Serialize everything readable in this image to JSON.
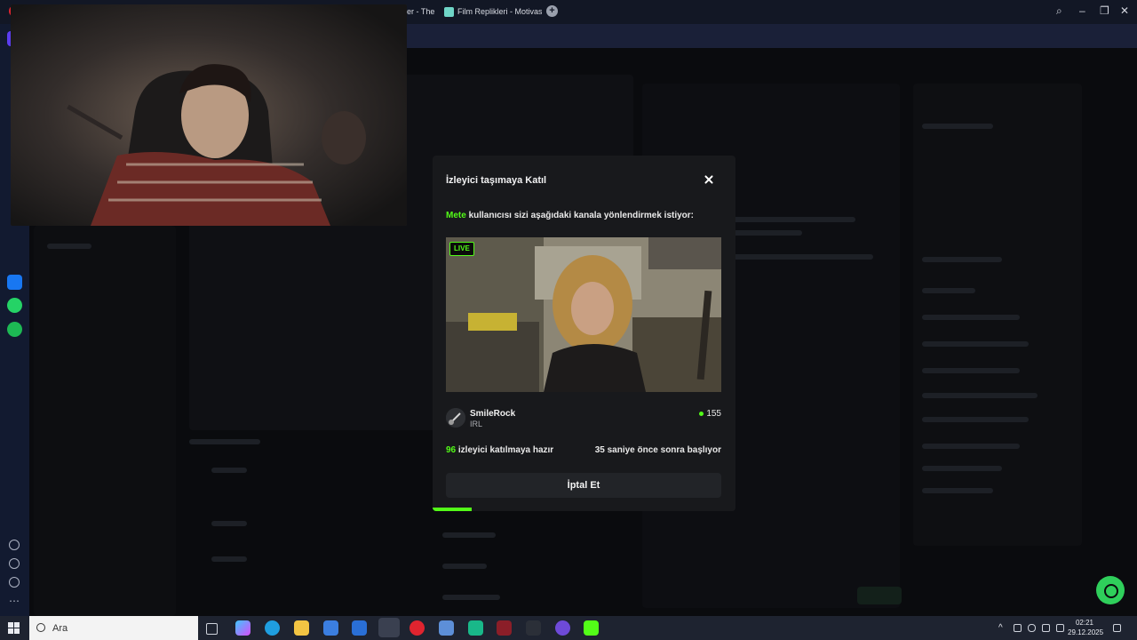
{
  "browser": {
    "tabs": [
      {
        "label": "The Godfather - The"
      },
      {
        "label": "Film Replikleri - Motivasyo"
      }
    ],
    "new_tab": "+",
    "ai_label": "AI"
  },
  "modal": {
    "title": "İzleyici taşımaya Katıl",
    "redirect_user": "Mete",
    "redirect_message": " kullanıcısı sizi aşağıdaki kanala yönlendirmek istiyor:",
    "live_badge": "LIVE",
    "channel": {
      "name": "SmileRock",
      "category": "IRL",
      "viewers": "155"
    },
    "ready_count": "96",
    "ready_label": " izleyici katılmaya hazır",
    "countdown": "35 saniye önce sonra başlıyor",
    "cancel_label": "İptal Et",
    "progress_fraction": 0.13
  },
  "taskbar": {
    "search_placeholder": "Ara",
    "time": "02:21",
    "date": "29.12.2025"
  },
  "colors": {
    "accent": "#53fc18",
    "modal_bg": "#18191c",
    "browser_bg": "#121725"
  }
}
